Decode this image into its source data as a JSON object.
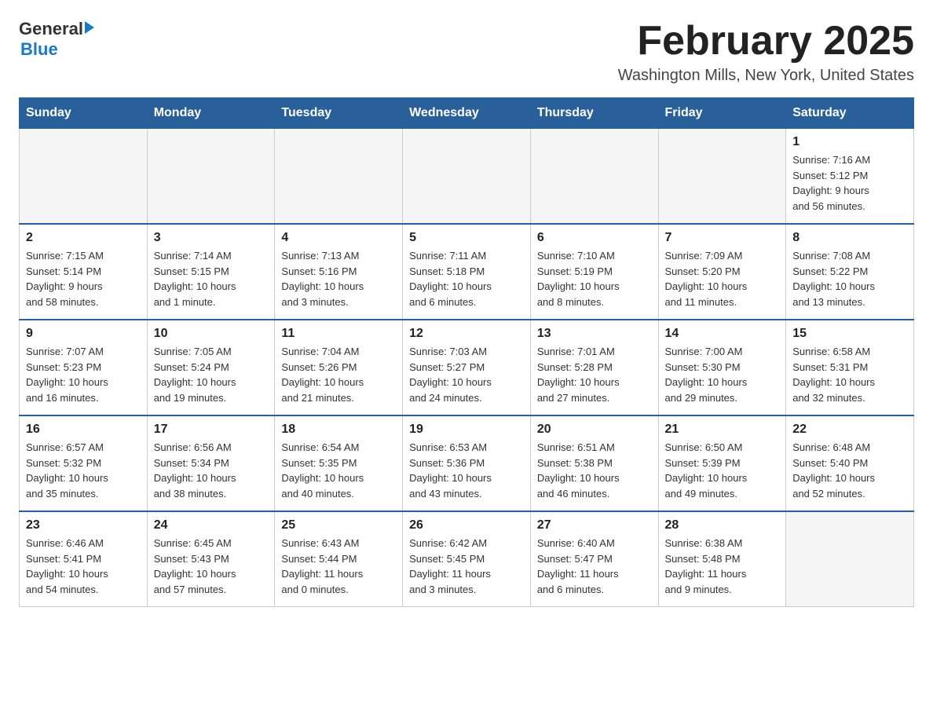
{
  "header": {
    "logo": {
      "general": "General",
      "blue": "Blue",
      "tagline": ""
    },
    "title": "February 2025",
    "location": "Washington Mills, New York, United States"
  },
  "calendar": {
    "weekdays": [
      "Sunday",
      "Monday",
      "Tuesday",
      "Wednesday",
      "Thursday",
      "Friday",
      "Saturday"
    ],
    "weeks": [
      [
        {
          "day": "",
          "info": ""
        },
        {
          "day": "",
          "info": ""
        },
        {
          "day": "",
          "info": ""
        },
        {
          "day": "",
          "info": ""
        },
        {
          "day": "",
          "info": ""
        },
        {
          "day": "",
          "info": ""
        },
        {
          "day": "1",
          "info": "Sunrise: 7:16 AM\nSunset: 5:12 PM\nDaylight: 9 hours\nand 56 minutes."
        }
      ],
      [
        {
          "day": "2",
          "info": "Sunrise: 7:15 AM\nSunset: 5:14 PM\nDaylight: 9 hours\nand 58 minutes."
        },
        {
          "day": "3",
          "info": "Sunrise: 7:14 AM\nSunset: 5:15 PM\nDaylight: 10 hours\nand 1 minute."
        },
        {
          "day": "4",
          "info": "Sunrise: 7:13 AM\nSunset: 5:16 PM\nDaylight: 10 hours\nand 3 minutes."
        },
        {
          "day": "5",
          "info": "Sunrise: 7:11 AM\nSunset: 5:18 PM\nDaylight: 10 hours\nand 6 minutes."
        },
        {
          "day": "6",
          "info": "Sunrise: 7:10 AM\nSunset: 5:19 PM\nDaylight: 10 hours\nand 8 minutes."
        },
        {
          "day": "7",
          "info": "Sunrise: 7:09 AM\nSunset: 5:20 PM\nDaylight: 10 hours\nand 11 minutes."
        },
        {
          "day": "8",
          "info": "Sunrise: 7:08 AM\nSunset: 5:22 PM\nDaylight: 10 hours\nand 13 minutes."
        }
      ],
      [
        {
          "day": "9",
          "info": "Sunrise: 7:07 AM\nSunset: 5:23 PM\nDaylight: 10 hours\nand 16 minutes."
        },
        {
          "day": "10",
          "info": "Sunrise: 7:05 AM\nSunset: 5:24 PM\nDaylight: 10 hours\nand 19 minutes."
        },
        {
          "day": "11",
          "info": "Sunrise: 7:04 AM\nSunset: 5:26 PM\nDaylight: 10 hours\nand 21 minutes."
        },
        {
          "day": "12",
          "info": "Sunrise: 7:03 AM\nSunset: 5:27 PM\nDaylight: 10 hours\nand 24 minutes."
        },
        {
          "day": "13",
          "info": "Sunrise: 7:01 AM\nSunset: 5:28 PM\nDaylight: 10 hours\nand 27 minutes."
        },
        {
          "day": "14",
          "info": "Sunrise: 7:00 AM\nSunset: 5:30 PM\nDaylight: 10 hours\nand 29 minutes."
        },
        {
          "day": "15",
          "info": "Sunrise: 6:58 AM\nSunset: 5:31 PM\nDaylight: 10 hours\nand 32 minutes."
        }
      ],
      [
        {
          "day": "16",
          "info": "Sunrise: 6:57 AM\nSunset: 5:32 PM\nDaylight: 10 hours\nand 35 minutes."
        },
        {
          "day": "17",
          "info": "Sunrise: 6:56 AM\nSunset: 5:34 PM\nDaylight: 10 hours\nand 38 minutes."
        },
        {
          "day": "18",
          "info": "Sunrise: 6:54 AM\nSunset: 5:35 PM\nDaylight: 10 hours\nand 40 minutes."
        },
        {
          "day": "19",
          "info": "Sunrise: 6:53 AM\nSunset: 5:36 PM\nDaylight: 10 hours\nand 43 minutes."
        },
        {
          "day": "20",
          "info": "Sunrise: 6:51 AM\nSunset: 5:38 PM\nDaylight: 10 hours\nand 46 minutes."
        },
        {
          "day": "21",
          "info": "Sunrise: 6:50 AM\nSunset: 5:39 PM\nDaylight: 10 hours\nand 49 minutes."
        },
        {
          "day": "22",
          "info": "Sunrise: 6:48 AM\nSunset: 5:40 PM\nDaylight: 10 hours\nand 52 minutes."
        }
      ],
      [
        {
          "day": "23",
          "info": "Sunrise: 6:46 AM\nSunset: 5:41 PM\nDaylight: 10 hours\nand 54 minutes."
        },
        {
          "day": "24",
          "info": "Sunrise: 6:45 AM\nSunset: 5:43 PM\nDaylight: 10 hours\nand 57 minutes."
        },
        {
          "day": "25",
          "info": "Sunrise: 6:43 AM\nSunset: 5:44 PM\nDaylight: 11 hours\nand 0 minutes."
        },
        {
          "day": "26",
          "info": "Sunrise: 6:42 AM\nSunset: 5:45 PM\nDaylight: 11 hours\nand 3 minutes."
        },
        {
          "day": "27",
          "info": "Sunrise: 6:40 AM\nSunset: 5:47 PM\nDaylight: 11 hours\nand 6 minutes."
        },
        {
          "day": "28",
          "info": "Sunrise: 6:38 AM\nSunset: 5:48 PM\nDaylight: 11 hours\nand 9 minutes."
        },
        {
          "day": "",
          "info": ""
        }
      ]
    ]
  }
}
